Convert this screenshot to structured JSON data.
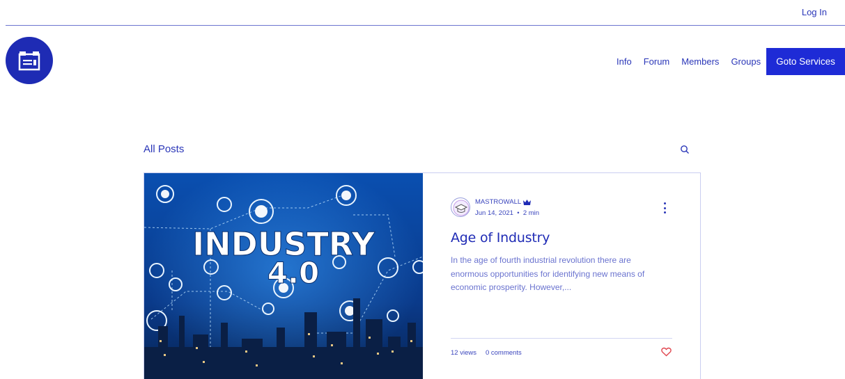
{
  "header": {
    "login_label": "Log In",
    "nav": [
      "Info",
      "Forum",
      "Members",
      "Groups"
    ],
    "cta_label": "Goto Services"
  },
  "feed": {
    "heading": "All Posts"
  },
  "post": {
    "image_text_1": "INDUSTRY",
    "image_text_2": "4.0",
    "author": "MASTROWALL",
    "date": "Jun 14, 2021",
    "read_time": "2 min",
    "title": "Age of Industry",
    "excerpt": "In the age of fourth industrial revolution there are enormous opportunities for identifying new means of economic prosperity. However,...",
    "views": "12 views",
    "comments": "0 comments"
  },
  "colors": {
    "brand": "#1e2bb4",
    "cta": "#1e2bd6",
    "like": "#e0464f"
  },
  "icons": [
    "logo-icon",
    "search-icon",
    "crown-icon",
    "more-icon",
    "heart-icon"
  ]
}
